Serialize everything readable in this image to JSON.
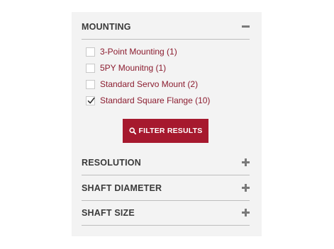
{
  "colors": {
    "accent": "#a6192e",
    "link": "#8b1c2f",
    "panel_bg": "#f3f3f3",
    "heading": "#3a3a3a"
  },
  "mounting": {
    "title": "MOUNTING",
    "toggle_icon": "minus-icon",
    "expanded": true,
    "options": [
      {
        "label": "3-Point Mounting (1)",
        "checked": false
      },
      {
        "label": "5PY Mounitng (1)",
        "checked": false
      },
      {
        "label": "Standard Servo Mount (2)",
        "checked": false
      },
      {
        "label": "Standard Square Flange (10)",
        "checked": true
      }
    ],
    "filter_button_label": "FILTER RESULTS",
    "filter_button_icon": "search-icon"
  },
  "resolution": {
    "title": "RESOLUTION",
    "toggle_icon": "plus-icon",
    "expanded": false
  },
  "shaft_diameter": {
    "title": "SHAFT DIAMETER",
    "toggle_icon": "plus-icon",
    "expanded": false
  },
  "shaft_size": {
    "title": "SHAFT SIZE",
    "toggle_icon": "plus-icon",
    "expanded": false
  }
}
